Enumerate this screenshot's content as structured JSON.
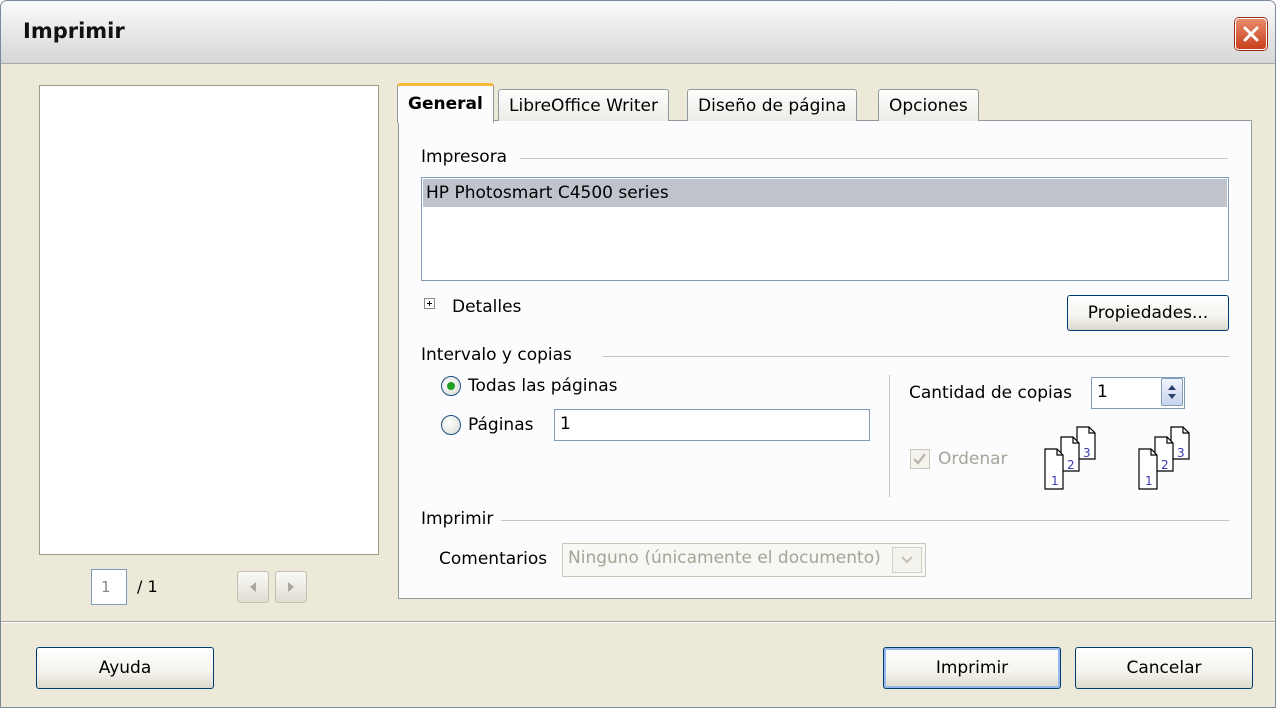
{
  "window": {
    "title": "Imprimir"
  },
  "preview": {
    "page_value": "1",
    "page_total": "/ 1"
  },
  "tabs": [
    {
      "label": "General"
    },
    {
      "label": "LibreOffice Writer"
    },
    {
      "label": "Diseño de página"
    },
    {
      "label": "Opciones"
    }
  ],
  "printer": {
    "group_label": "Impresora",
    "items": [
      "HP Photosmart C4500 series"
    ],
    "details_label": "Detalles",
    "properties_button": "Propiedades..."
  },
  "range": {
    "group_label": "Intervalo y copias",
    "all_pages_label": "Todas las páginas",
    "pages_label": "Páginas",
    "pages_value": "1",
    "copies_label": "Cantidad de copias",
    "copies_value": "1",
    "collate_label": "Ordenar"
  },
  "print": {
    "group_label": "Imprimir",
    "comments_label": "Comentarios",
    "comments_value": "Ninguno (únicamente el documento)"
  },
  "buttons": {
    "help": "Ayuda",
    "print": "Imprimir",
    "cancel": "Cancelar"
  }
}
